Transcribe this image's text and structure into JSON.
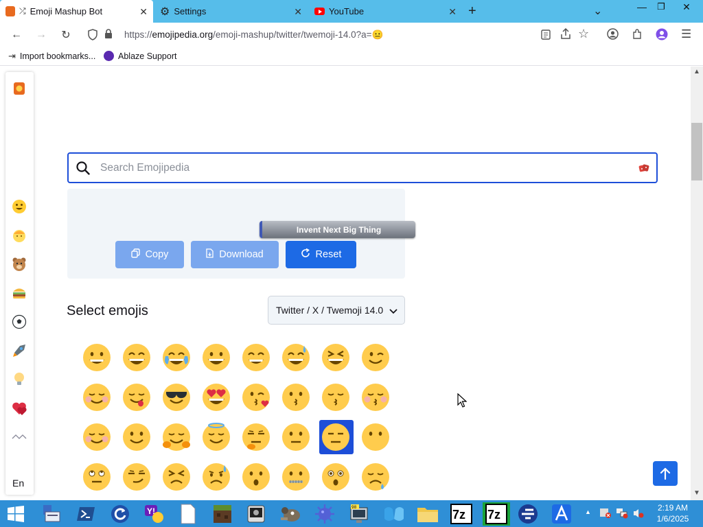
{
  "browser": {
    "tabs": [
      {
        "label": "Emoji Mashup Bot",
        "icon": "emojipedia-icon",
        "active": true
      },
      {
        "label": "Settings",
        "icon": "gear-icon",
        "active": false
      },
      {
        "label": "YouTube",
        "icon": "youtube-icon",
        "active": false
      }
    ],
    "new_tab_symbol": "+",
    "url_prefix": "https://",
    "url_domain": "emojipedia.org",
    "url_path": "/emoji-mashup/twitter/twemoji-14.0?a=😐",
    "bookmarks": [
      {
        "label": "Import bookmarks...",
        "icon": "import-icon"
      },
      {
        "label": "Ablaze Support",
        "icon": "ablaze-icon"
      }
    ]
  },
  "sidebar": {
    "categories": [
      "smileys",
      "people",
      "animals",
      "food",
      "activities",
      "travel",
      "objects",
      "symbols",
      "flags"
    ],
    "language": "En"
  },
  "search": {
    "placeholder": "Search Emojipedia"
  },
  "mashup": {
    "tooltip": "Invent Next Big Thing",
    "copy_label": "Copy",
    "download_label": "Download",
    "reset_label": "Reset"
  },
  "select": {
    "title": "Select emojis",
    "vendor_value": "Twitter / X / Twemoji 14.0"
  },
  "emoji_grid": {
    "selected_index": 22,
    "rows": [
      [
        "grinning",
        "grin",
        "tears-of-joy",
        "smiley",
        "smile",
        "sweat-smile",
        "laughing",
        "wink"
      ],
      [
        "blush",
        "yum",
        "sunglasses",
        "heart-eyes",
        "kissing-heart",
        "kissing",
        "kissing-smiling",
        "kissing-closed-eyes"
      ],
      [
        "smiling-hearts",
        "slight-smile",
        "hugging",
        "innocent",
        "thinking",
        "neutral",
        "expressionless",
        "no-mouth"
      ],
      [
        "eye-roll",
        "smirk",
        "persevere",
        "disappointed-relieved",
        "hushed",
        "zipper-mouth",
        "astonished",
        "sleepy"
      ]
    ]
  },
  "taskbar": {
    "time": "2:19 AM",
    "date": "1/6/2025",
    "apps": [
      "start",
      "explorer",
      "powershell",
      "refresh",
      "yahoo",
      "document",
      "minecraft",
      "terminal",
      "gimp",
      "virus",
      "monitor",
      "winget",
      "folder",
      "7zip",
      "7zip-green",
      "firefox-alt",
      "arc"
    ]
  },
  "colors": {
    "accent": "#1d4ed8",
    "tab_bar": "#56bdea",
    "taskbar": "#2f8fd6",
    "panel": "#f1f5f9",
    "disabled_button": "#7aa7ee"
  }
}
